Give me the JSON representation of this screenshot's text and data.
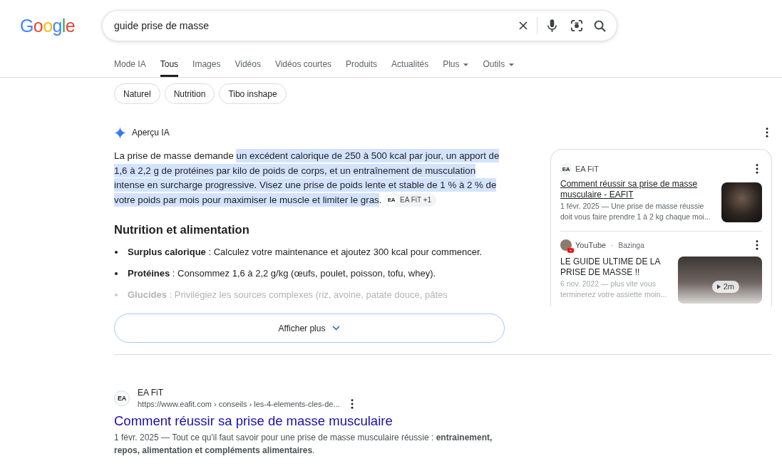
{
  "header": {
    "logo": "Google",
    "search": {
      "value": "guide prise de masse"
    }
  },
  "tabs": [
    {
      "label": "Mode IA",
      "selected": false,
      "dropdown": false
    },
    {
      "label": "Tous",
      "selected": true,
      "dropdown": false
    },
    {
      "label": "Images",
      "selected": false,
      "dropdown": false
    },
    {
      "label": "Vidéos",
      "selected": false,
      "dropdown": false
    },
    {
      "label": "Vidéos courtes",
      "selected": false,
      "dropdown": false
    },
    {
      "label": "Produits",
      "selected": false,
      "dropdown": false
    },
    {
      "label": "Actualités",
      "selected": false,
      "dropdown": false
    },
    {
      "label": "Plus",
      "selected": false,
      "dropdown": true
    },
    {
      "label": "Outils",
      "selected": false,
      "dropdown": true
    }
  ],
  "chips": [
    "Naturel",
    "Nutrition",
    "Tibo inshape"
  ],
  "ai_overview": {
    "title": "Aperçu IA",
    "paragraph": {
      "text_before": "La prise de masse demande ",
      "highlighted": "un excédent calorique de 250 à 500 kcal par jour, un apport de 1,6 à 2,2 g de protéines par kilo de poids de corps, et un entraînement de musculation intense en surcharge progressive. Visez une prise de poids lente et stable de 1 % à 2 % de votre poids par mois pour maximiser le muscle et limiter le gras",
      "text_after": ".",
      "citation": {
        "logo": "EA",
        "label": "EA FiT +1"
      }
    },
    "section_title": "Nutrition et alimentation",
    "bullets": [
      {
        "text": "**Surplus calorique** : Calculez votre maintenance et ajoutez 300 kcal pour commencer.",
        "faded": false
      },
      {
        "text": "**Protéines** : Consommez 1,6 à 2,2 g/kg (œufs, poulet, poisson, tofu, whey).",
        "faded": false
      },
      {
        "text": "**Glucides** : Privilégiez les sources complexes (riz, avoine, patate douce, pâtes",
        "faded": true
      }
    ],
    "more_button": "Afficher plus",
    "sources": [
      {
        "kind": "article",
        "logo": "EA",
        "site": "EA FiT",
        "title": "Comment réussir sa prise de masse musculaire - EAFIT",
        "snippet": "1 févr. 2025 — Une prise de masse réussie doit vous faire prendre 1 à 2 kg chaque moi...",
        "hovered": true,
        "faded": false
      },
      {
        "kind": "video",
        "site": "YouTube",
        "separator": "·",
        "channel": "Bazinga",
        "title": "LE GUIDE ULTIME DE LA PRISE DE MASSE !!",
        "snippet": "6 nov. 2022 — plus vite vous terminerez votre assiette moin...",
        "duration": "2m",
        "hovered": false,
        "faded": true
      }
    ]
  },
  "results": [
    {
      "logo": "EA",
      "site": "EA FiT",
      "url": "https://www.eafit.com › conseils › les-4-elements-cles-de...",
      "title": "Comment réussir sa prise de masse musculaire",
      "snippet": "1 févr. 2025 — Tout ce qu'il faut savoir pour une prise de masse musculaire réussie : **entrainement, repos, alimentation et compléments alimentaires**."
    }
  ]
}
